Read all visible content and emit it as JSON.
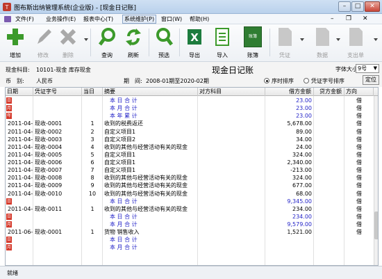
{
  "window": {
    "title": "图布斯出纳管理系统(企业版) - [现金日记账]",
    "minimize": "–",
    "maximize": "□",
    "close": "✕"
  },
  "menu": [
    "文件(F)",
    "业务操作(E)",
    "报表中心(T)",
    "系统维护(P)",
    "窗口(W)",
    "帮助(H)"
  ],
  "toolbar": {
    "add": "增加",
    "edit": "修改",
    "delete": "删除",
    "query": "查询",
    "refresh": "刷新",
    "preview": "预选",
    "export": "导出",
    "import": "导入",
    "account": "账簿",
    "account_icon_text": "账簿",
    "voucher": "凭证",
    "data": "数据",
    "payment": "支出单"
  },
  "info": {
    "page_title": "现金日记账",
    "subject_label": "现金科目:",
    "subject_value": "10101-现金 库存现金",
    "currency_label": "币　别:",
    "currency_value": "人民币",
    "period_label": "期　间:",
    "period_value": "2008-01期至2020-02期",
    "fontsize_label": "字体大小:",
    "fontsize_value": "9号",
    "sort_time": "序时排序",
    "sort_voucher": "凭证字号排序",
    "locate": "定位"
  },
  "columns": [
    "日期",
    "凭证字号",
    "当日",
    "摘要",
    "对方科目",
    "借方金额",
    "贷方金额",
    "方向"
  ],
  "rows": [
    {
      "mark": "日",
      "date": "",
      "voucher": "",
      "day": "",
      "summary": "本 日 合 计",
      "counter": "",
      "debit": "23.00",
      "credit": "",
      "dir": "借",
      "sum": true
    },
    {
      "mark": "月",
      "date": "",
      "voucher": "",
      "day": "",
      "summary": "本 月 合 计",
      "counter": "",
      "debit": "23.00",
      "credit": "",
      "dir": "借",
      "sum": true
    },
    {
      "mark": "年",
      "date": "",
      "voucher": "",
      "day": "",
      "summary": "本 年 累 计",
      "counter": "",
      "debit": "23.00",
      "credit": "",
      "dir": "借",
      "sum": true
    },
    {
      "mark": "",
      "date": "2011-04-08",
      "voucher": "现收-0001",
      "day": "1",
      "summary": "收到的税费返还",
      "counter": "",
      "debit": "5,678.00",
      "credit": "",
      "dir": "借",
      "sum": false
    },
    {
      "mark": "",
      "date": "2011-04-08",
      "voucher": "现收-0002",
      "day": "2",
      "summary": "自定义项目1",
      "counter": "",
      "debit": "89.00",
      "credit": "",
      "dir": "借",
      "sum": false
    },
    {
      "mark": "",
      "date": "2011-04-08",
      "voucher": "现收-0003",
      "day": "3",
      "summary": "自定义项目2",
      "counter": "",
      "debit": "34.00",
      "credit": "",
      "dir": "借",
      "sum": false
    },
    {
      "mark": "",
      "date": "2011-04-08",
      "voucher": "现收-0004",
      "day": "4",
      "summary": "收到的其他与经营活动有关的现金",
      "counter": "",
      "debit": "24.00",
      "credit": "",
      "dir": "借",
      "sum": false
    },
    {
      "mark": "",
      "date": "2011-04-08",
      "voucher": "现收-0005",
      "day": "5",
      "summary": "自定义项目1",
      "counter": "",
      "debit": "324.00",
      "credit": "",
      "dir": "借",
      "sum": false
    },
    {
      "mark": "",
      "date": "2011-04-08",
      "voucher": "现收-0006",
      "day": "6",
      "summary": "自定义项目1",
      "counter": "",
      "debit": "2,340.00",
      "credit": "",
      "dir": "借",
      "sum": false
    },
    {
      "mark": "",
      "date": "2011-04-08",
      "voucher": "现收-0007",
      "day": "7",
      "summary": "自定义项目1",
      "counter": "",
      "debit": "-213.00",
      "credit": "",
      "dir": "借",
      "sum": false
    },
    {
      "mark": "",
      "date": "2011-04-08",
      "voucher": "现收-0008",
      "day": "8",
      "summary": "收到的其他与经营活动有关的现金",
      "counter": "",
      "debit": "324.00",
      "credit": "",
      "dir": "借",
      "sum": false
    },
    {
      "mark": "",
      "date": "2011-04-08",
      "voucher": "现收-0009",
      "day": "9",
      "summary": "收到的其他与经营活动有关的现金",
      "counter": "",
      "debit": "677.00",
      "credit": "",
      "dir": "借",
      "sum": false
    },
    {
      "mark": "",
      "date": "2011-04-08",
      "voucher": "现收-0010",
      "day": "10",
      "summary": "收到的其他与经营活动有关的现金",
      "counter": "",
      "debit": "68.00",
      "credit": "",
      "dir": "借",
      "sum": false
    },
    {
      "mark": "日",
      "date": "",
      "voucher": "",
      "day": "",
      "summary": "本 日 合 计",
      "counter": "",
      "debit": "9,345.00",
      "credit": "",
      "dir": "借",
      "sum": true
    },
    {
      "mark": "",
      "date": "2011-04-09",
      "voucher": "现收-0011",
      "day": "1",
      "summary": "收到的其他与经营活动有关的现金",
      "counter": "",
      "debit": "234.00",
      "credit": "",
      "dir": "借",
      "sum": false
    },
    {
      "mark": "日",
      "date": "",
      "voucher": "",
      "day": "",
      "summary": "本 日 合 计",
      "counter": "",
      "debit": "234.00",
      "credit": "",
      "dir": "借",
      "sum": true
    },
    {
      "mark": "月",
      "date": "",
      "voucher": "",
      "day": "",
      "summary": "本 月 合 计",
      "counter": "",
      "debit": "9,579.00",
      "credit": "",
      "dir": "借",
      "sum": true
    },
    {
      "mark": "",
      "date": "2011-06-15",
      "voucher": "现收-0001",
      "day": "1",
      "summary": "货物 销售收入",
      "counter": "",
      "debit": "1,521.00",
      "credit": "",
      "dir": "借",
      "sum": false
    },
    {
      "mark": "日",
      "date": "",
      "voucher": "",
      "day": "",
      "summary": "本 日 合 计",
      "counter": "",
      "debit": "",
      "credit": "",
      "dir": "",
      "sum": true
    },
    {
      "mark": "月",
      "date": "",
      "voucher": "",
      "day": "",
      "summary": "本 月 合 计",
      "counter": "",
      "debit": "",
      "credit": "",
      "dir": "",
      "sum": true
    }
  ],
  "status": "就绪"
}
